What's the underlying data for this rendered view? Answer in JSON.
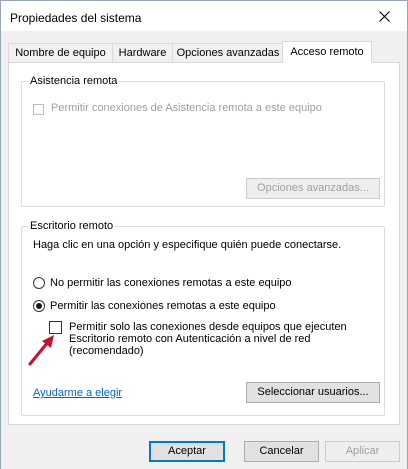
{
  "window": {
    "title": "Propiedades del sistema"
  },
  "tabs": [
    {
      "label": "Nombre de equipo",
      "active": false
    },
    {
      "label": "Hardware",
      "active": false
    },
    {
      "label": "Opciones avanzadas",
      "active": false
    },
    {
      "label": "Acceso remoto",
      "active": true
    }
  ],
  "remote_assistance": {
    "legend": "Asistencia remota",
    "checkbox_label": "Permitir conexiones de Asistencia remota a este equipo",
    "checkbox_checked": false,
    "checkbox_enabled": false,
    "advanced_button": "Opciones avanzadas...",
    "advanced_enabled": false
  },
  "remote_desktop": {
    "legend": "Escritorio remoto",
    "instruction": "Haga clic en una opción y especifique quién puede conectarse.",
    "option_deny": "No permitir las conexiones remotas a este equipo",
    "option_deny_selected": false,
    "option_allow": "Permitir las conexiones remotas a este equipo",
    "option_allow_selected": true,
    "nla_line1": "Permitir solo las conexiones desde equipos que ejecuten",
    "nla_line2": "Escritorio remoto con Autenticación a nivel de red",
    "nla_line3": "(recomendado)",
    "nla_checked": false,
    "help_link": "Ayudarme a elegir",
    "select_users_button": "Seleccionar usuarios..."
  },
  "footer": {
    "ok": "Aceptar",
    "cancel": "Cancelar",
    "apply": "Aplicar",
    "apply_enabled": false
  },
  "colors": {
    "accent": "#0078d7",
    "annotation_arrow": "#c8102e",
    "link": "#0066cc",
    "disabled_text": "#a0a0a0"
  }
}
